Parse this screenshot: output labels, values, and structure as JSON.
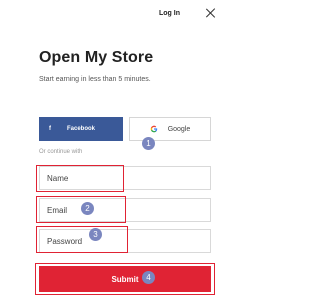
{
  "header": {
    "login_label": "Log In"
  },
  "main": {
    "title": "Open My Store",
    "subtitle": "Start earning in less than 5 minutes."
  },
  "social": {
    "facebook_label": "Facebook",
    "facebook_icon_glyph": "f",
    "google_label": "Google"
  },
  "divider_text": "Or continue with",
  "form": {
    "name_placeholder": "Name",
    "email_placeholder": "Email",
    "password_placeholder": "Password",
    "submit_label": "Submit"
  },
  "annotations": [
    {
      "label": "1"
    },
    {
      "label": "2"
    },
    {
      "label": "3"
    },
    {
      "label": "4"
    }
  ],
  "colors": {
    "facebook": "#3a5998",
    "submit": "#e02334",
    "highlight": "#e02334",
    "badge": "#7a86bf"
  }
}
